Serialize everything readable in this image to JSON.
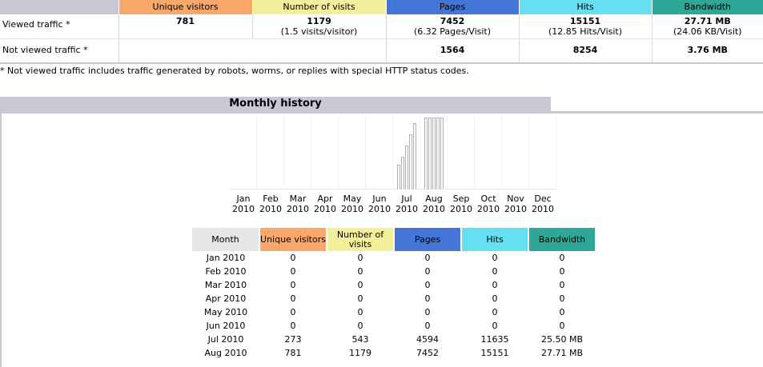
{
  "summary": {
    "headers": {
      "visitors": "Unique visitors",
      "visits": "Number of visits",
      "pages": "Pages",
      "hits": "Hits",
      "bandwidth": "Bandwidth"
    },
    "viewed": {
      "label": "Viewed traffic *",
      "visitors": "781",
      "visits": "1179",
      "visits_sub": "(1.5 visits/visitor)",
      "pages": "7452",
      "pages_sub": "(6.32 Pages/Visit)",
      "hits": "15151",
      "hits_sub": "(12.85 Hits/Visit)",
      "bandwidth": "27.71 MB",
      "bandwidth_sub": "(24.06 KB/Visit)"
    },
    "not_viewed": {
      "label": "Not viewed traffic *",
      "pages": "1564",
      "hits": "8254",
      "bandwidth": "3.76 MB"
    },
    "footnote": "* Not viewed traffic includes traffic generated by robots, worms, or replies with special HTTP status codes."
  },
  "monthly": {
    "title": "Monthly history",
    "headers": {
      "month": "Month",
      "visitors": "Unique visitors",
      "visits": "Number of visits",
      "pages": "Pages",
      "hits": "Hits",
      "bandwidth": "Bandwidth"
    },
    "rows": [
      {
        "month": "Jan 2010",
        "visitors": "0",
        "visits": "0",
        "pages": "0",
        "hits": "0",
        "bandwidth": "0"
      },
      {
        "month": "Feb 2010",
        "visitors": "0",
        "visits": "0",
        "pages": "0",
        "hits": "0",
        "bandwidth": "0"
      },
      {
        "month": "Mar 2010",
        "visitors": "0",
        "visits": "0",
        "pages": "0",
        "hits": "0",
        "bandwidth": "0"
      },
      {
        "month": "Apr 2010",
        "visitors": "0",
        "visits": "0",
        "pages": "0",
        "hits": "0",
        "bandwidth": "0"
      },
      {
        "month": "May 2010",
        "visitors": "0",
        "visits": "0",
        "pages": "0",
        "hits": "0",
        "bandwidth": "0"
      },
      {
        "month": "Jun 2010",
        "visitors": "0",
        "visits": "0",
        "pages": "0",
        "hits": "0",
        "bandwidth": "0"
      },
      {
        "month": "Jul 2010",
        "visitors": "273",
        "visits": "543",
        "pages": "4594",
        "hits": "11635",
        "bandwidth": "25.50 MB"
      },
      {
        "month": "Aug 2010",
        "visitors": "781",
        "visits": "1179",
        "pages": "7452",
        "hits": "15151",
        "bandwidth": "27.71 MB"
      }
    ]
  },
  "chart_data": {
    "type": "bar",
    "categories": [
      "Jan 2010",
      "Feb 2010",
      "Mar 2010",
      "Apr 2010",
      "May 2010",
      "Jun 2010",
      "Jul 2010",
      "Aug 2010",
      "Sep 2010",
      "Oct 2010",
      "Nov 2010",
      "Dec 2010"
    ],
    "month_labels": [
      {
        "mon": "Jan",
        "year": "2010"
      },
      {
        "mon": "Feb",
        "year": "2010"
      },
      {
        "mon": "Mar",
        "year": "2010"
      },
      {
        "mon": "Apr",
        "year": "2010"
      },
      {
        "mon": "May",
        "year": "2010"
      },
      {
        "mon": "Jun",
        "year": "2010"
      },
      {
        "mon": "Jul",
        "year": "2010"
      },
      {
        "mon": "Aug",
        "year": "2010"
      },
      {
        "mon": "Sep",
        "year": "2010"
      },
      {
        "mon": "Oct",
        "year": "2010"
      },
      {
        "mon": "Nov",
        "year": "2010"
      },
      {
        "mon": "Dec",
        "year": "2010"
      }
    ],
    "series": [
      {
        "key": "visitors",
        "values": [
          0,
          0,
          0,
          0,
          0,
          0,
          273,
          781,
          0,
          0,
          0,
          0
        ]
      },
      {
        "key": "visits",
        "values": [
          0,
          0,
          0,
          0,
          0,
          0,
          543,
          1179,
          0,
          0,
          0,
          0
        ]
      },
      {
        "key": "pages",
        "values": [
          0,
          0,
          0,
          0,
          0,
          0,
          4594,
          7452,
          0,
          0,
          0,
          0
        ]
      },
      {
        "key": "hits",
        "values": [
          0,
          0,
          0,
          0,
          0,
          0,
          11635,
          15151,
          0,
          0,
          0,
          0
        ]
      },
      {
        "key": "bandwidth",
        "values": [
          0,
          0,
          0,
          0,
          0,
          0,
          25.5,
          27.71,
          0,
          0,
          0,
          0
        ]
      }
    ],
    "grid": false,
    "legend": "none",
    "colors": {
      "visitors": "#f9a76b",
      "visits": "#f3f09c",
      "pages": "#4476d8",
      "hits": "#66e0f0",
      "bandwidth": "#2ea796",
      "bar_outline": "#b2b2b2",
      "section_header": "#c9c9d6"
    }
  }
}
